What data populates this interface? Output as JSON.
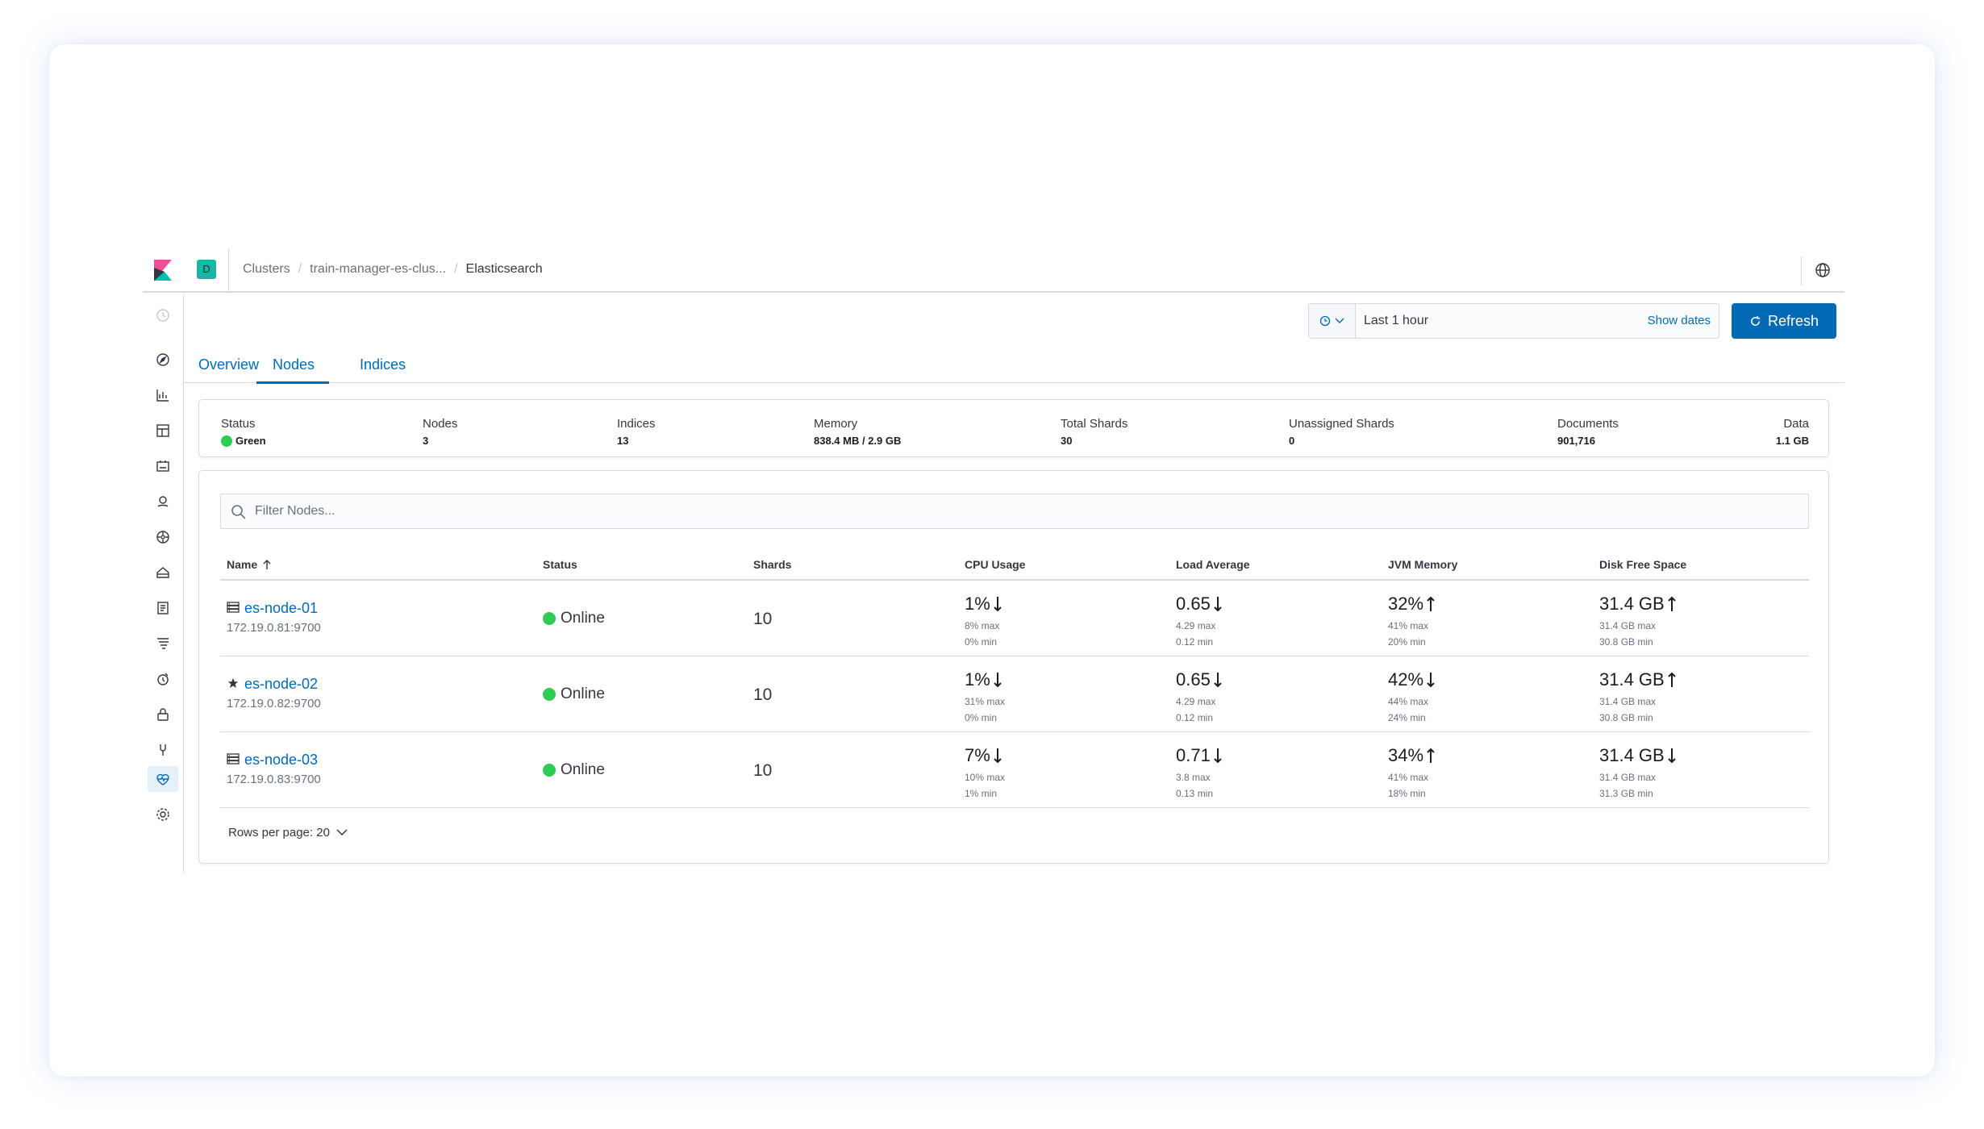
{
  "header": {
    "space_initial": "D",
    "breadcrumbs": [
      "Clusters",
      "train-manager-es-clus...",
      "Elasticsearch"
    ]
  },
  "datepicker": {
    "range": "Last 1 hour",
    "show_dates": "Show dates"
  },
  "refresh_label": "Refresh",
  "tabs": [
    {
      "label": "Overview",
      "selected": false
    },
    {
      "label": "Nodes",
      "selected": true
    },
    {
      "label": "Indices",
      "selected": false
    }
  ],
  "summary": [
    {
      "label": "Status",
      "value": "Green"
    },
    {
      "label": "Nodes",
      "value": "3"
    },
    {
      "label": "Indices",
      "value": "13"
    },
    {
      "label": "Memory",
      "value": "838.4 MB / 2.9 GB"
    },
    {
      "label": "Total Shards",
      "value": "30"
    },
    {
      "label": "Unassigned Shards",
      "value": "0"
    },
    {
      "label": "Documents",
      "value": "901,716"
    },
    {
      "label": "Data",
      "value": "1.1 GB"
    }
  ],
  "filter": {
    "placeholder": "Filter Nodes..."
  },
  "columns": [
    "Name",
    "Status",
    "Shards",
    "CPU Usage",
    "Load Average",
    "JVM Memory",
    "Disk Free Space"
  ],
  "nodes": [
    {
      "icon": "server-icon",
      "name": "es-node-01",
      "address": "172.19.0.81:9700",
      "status": "Online",
      "shards": "10",
      "cpu": {
        "value": "1%",
        "trend": "down",
        "max": "8% max",
        "min": "0% min"
      },
      "load": {
        "value": "0.65",
        "trend": "down",
        "max": "4.29 max",
        "min": "0.12 min"
      },
      "jvm": {
        "value": "32%",
        "trend": "up",
        "max": "41% max",
        "min": "20% min"
      },
      "disk": {
        "value": "31.4 GB",
        "trend": "up",
        "max": "31.4 GB max",
        "min": "30.8 GB min"
      }
    },
    {
      "icon": "star-icon",
      "name": "es-node-02",
      "address": "172.19.0.82:9700",
      "status": "Online",
      "shards": "10",
      "cpu": {
        "value": "1%",
        "trend": "down",
        "max": "31% max",
        "min": "0% min"
      },
      "load": {
        "value": "0.65",
        "trend": "down",
        "max": "4.29 max",
        "min": "0.12 min"
      },
      "jvm": {
        "value": "42%",
        "trend": "down",
        "max": "44% max",
        "min": "24% min"
      },
      "disk": {
        "value": "31.4 GB",
        "trend": "up",
        "max": "31.4 GB max",
        "min": "30.8 GB min"
      }
    },
    {
      "icon": "server-icon",
      "name": "es-node-03",
      "address": "172.19.0.83:9700",
      "status": "Online",
      "shards": "10",
      "cpu": {
        "value": "7%",
        "trend": "down",
        "max": "10% max",
        "min": "1% min"
      },
      "load": {
        "value": "0.71",
        "trend": "down",
        "max": "3.8 max",
        "min": "0.13 min"
      },
      "jvm": {
        "value": "34%",
        "trend": "up",
        "max": "41% max",
        "min": "18% min"
      },
      "disk": {
        "value": "31.4 GB",
        "trend": "down",
        "max": "31.4 GB max",
        "min": "31.3 GB min"
      }
    }
  ],
  "pagination": {
    "rows_per_page": "Rows per page: 20"
  },
  "colors": {
    "accent": "#006bb4",
    "status_green": "#2ecc52",
    "border": "#d3dae6"
  },
  "sidenav_icons": [
    "recent-icon",
    "discover-icon",
    "visualize-icon",
    "dashboard-icon",
    "canvas-icon",
    "maps-icon",
    "ml-icon",
    "infrastructure-icon",
    "logs-icon",
    "apm-icon",
    "uptime-icon",
    "siem-icon",
    "dev-tools-icon",
    "monitoring-icon",
    "management-icon"
  ]
}
